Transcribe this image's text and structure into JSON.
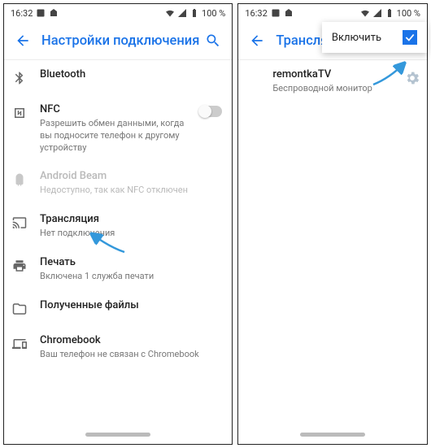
{
  "status": {
    "time": "16:32",
    "battery": "100 %"
  },
  "left": {
    "title": "Настройки подключения",
    "items": [
      {
        "icon": "bluetooth",
        "title": "Bluetooth"
      },
      {
        "icon": "nfc",
        "title": "NFC",
        "sub": "Разрешить обмен данными, когда вы подносите телефон к другому устройству",
        "toggle": true
      },
      {
        "icon": "beam",
        "title": "Android Beam",
        "sub": "Недоступно, так как NFC отключен",
        "disabled": true
      },
      {
        "icon": "cast",
        "title": "Трансляция",
        "sub": "Нет подключения"
      },
      {
        "icon": "print",
        "title": "Печать",
        "sub": "Включена 1 служба печати"
      },
      {
        "icon": "folder",
        "title": "Полученные файлы"
      },
      {
        "icon": "chromebook",
        "title": "Chromebook",
        "sub": "Ваш телефон не связан с Chromebook"
      }
    ]
  },
  "right": {
    "title": "Трансляция",
    "popup": {
      "label": "Включить",
      "checked": true
    },
    "device": {
      "name": "remontkaTV",
      "sub": "Беспроводной монитор"
    }
  }
}
